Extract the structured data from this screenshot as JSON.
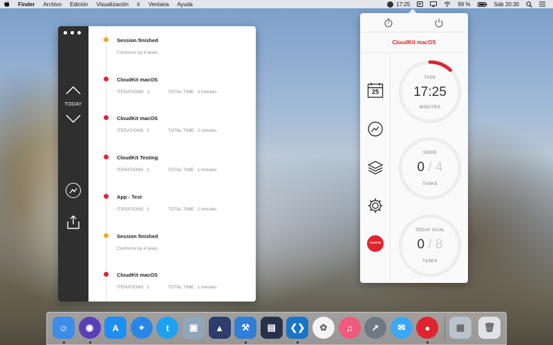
{
  "menubar": {
    "apple": "",
    "items": [
      "Finder",
      "Archivo",
      "Edición",
      "Visualización",
      "Ir",
      "Ventana",
      "Ayuda"
    ],
    "time_tracker": "17:25",
    "battery": "99 %",
    "clock": "Sáb 20:30"
  },
  "timeline": {
    "today_label": "TODAY",
    "entries": [
      {
        "title": "Session finished",
        "type": "session",
        "sub": "Conforms by 4 tasks"
      },
      {
        "title": "CloudKit macOS",
        "type": "task",
        "iter_label": "ITERATIONS",
        "iter": "3",
        "time_label": "TOTAL TIME",
        "time": "3 minutes"
      },
      {
        "title": "CloudKit macOS",
        "type": "task",
        "iter_label": "ITERATIONS",
        "iter": "2",
        "time_label": "TOTAL TIME",
        "time": "2 minutes"
      },
      {
        "title": "CloudKit Testing",
        "type": "task",
        "iter_label": "ITERATIONS",
        "iter": "1",
        "time_label": "TOTAL TIME",
        "time": "1 minutes"
      },
      {
        "title": "App - Test",
        "type": "task",
        "iter_label": "ITERATIONS",
        "iter": "1",
        "time_label": "TOTAL TIME",
        "time": "1 minutes"
      },
      {
        "title": "Session finished",
        "type": "session",
        "sub": "Conforms by 4 tasks"
      },
      {
        "title": "CloudKit macOS",
        "type": "task",
        "iter_label": "ITERATIONS",
        "iter": "1",
        "time_label": "TOTAL TIME",
        "time": "1 minutes"
      }
    ],
    "colors": {
      "session": "#f5a623",
      "task": "#e0242e"
    }
  },
  "popover": {
    "project": "CloudKit macOS",
    "calendar_day": "25",
    "logo_text": "TOMATES",
    "task": {
      "label": "TASK",
      "value": "17:25",
      "unit": "MINUTES",
      "progress": 0.12
    },
    "serie": {
      "label": "SERIE",
      "done": "0",
      "total": "4",
      "unit": "TASKS",
      "progress": 0
    },
    "goal": {
      "label": "TODAY GOAL",
      "done": "0",
      "total": "8",
      "unit": "TASKS",
      "progress": 0
    },
    "accent": "#e0242e"
  },
  "dock": {
    "icons": [
      {
        "name": "finder-icon",
        "color": "#3d8ce8",
        "glyph": "☺",
        "running": true
      },
      {
        "name": "siri-icon",
        "color": "#5a3fb8",
        "glyph": "◉",
        "running": true
      },
      {
        "name": "app-store-icon",
        "color": "#1e8ff0",
        "glyph": "A",
        "running": false
      },
      {
        "name": "safari-icon",
        "color": "#2a86e6",
        "glyph": "⌖",
        "running": false
      },
      {
        "name": "twitter-icon",
        "color": "#1da1f2",
        "glyph": "t",
        "running": false
      },
      {
        "name": "preview-icon",
        "color": "#8fa7b8",
        "glyph": "▣",
        "running": false
      },
      {
        "name": "affinity-designer-icon",
        "color": "#2c3e6e",
        "glyph": "▲",
        "running": false
      },
      {
        "name": "xcode-icon",
        "color": "#2f7fd6",
        "glyph": "⚒",
        "running": true
      },
      {
        "name": "quicktime-icon",
        "color": "#27324a",
        "glyph": "▤",
        "running": false
      },
      {
        "name": "visual-studio-code-icon",
        "color": "#1a74c6",
        "glyph": "❮❯",
        "running": true
      },
      {
        "name": "photos-icon",
        "color": "#f4f4f4",
        "glyph": "✿",
        "running": false
      },
      {
        "name": "music-icon",
        "color": "#f05a7e",
        "glyph": "♫",
        "running": false
      },
      {
        "name": "launchpad-icon",
        "color": "#6f7885",
        "glyph": "➚",
        "running": false
      },
      {
        "name": "messages-icon",
        "color": "#39a8f5",
        "glyph": "✉",
        "running": false
      },
      {
        "name": "tomates-icon",
        "color": "#e0242e",
        "glyph": "●",
        "running": true
      },
      {
        "name": "downloads-stack-icon",
        "color": "#b9c3cc",
        "glyph": "▦",
        "running": false
      },
      {
        "name": "trash-icon",
        "color": "#dfe3e6",
        "glyph": "🗑",
        "running": false
      }
    ]
  }
}
